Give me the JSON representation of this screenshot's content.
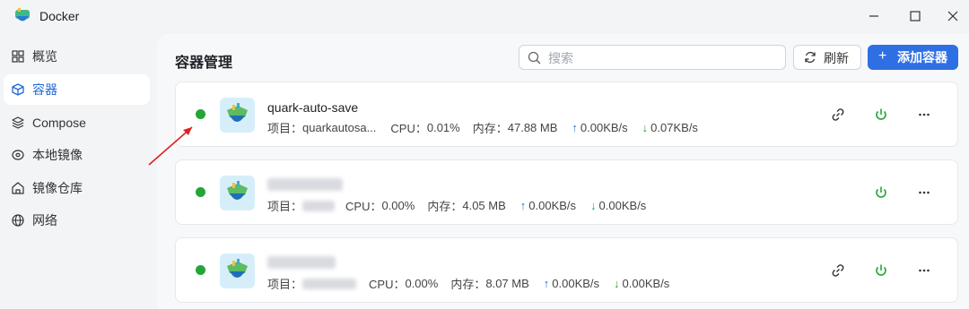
{
  "app": {
    "title": "Docker"
  },
  "sidebar": {
    "items": [
      {
        "label": "概览",
        "icon": "grid-icon"
      },
      {
        "label": "容器",
        "icon": "cube-icon"
      },
      {
        "label": "Compose",
        "icon": "layers-icon"
      },
      {
        "label": "本地镜像",
        "icon": "disc-icon"
      },
      {
        "label": "镜像仓库",
        "icon": "home-icon"
      },
      {
        "label": "网络",
        "icon": "globe-icon"
      }
    ],
    "active_index": 1
  },
  "main": {
    "title": "容器管理",
    "search": {
      "placeholder": "搜索",
      "value": ""
    },
    "refresh_label": "刷新",
    "add_label": "添加容器"
  },
  "containers": [
    {
      "name": "quark-auto-save",
      "status": "running",
      "project_label": "项目：",
      "project": "quarkautosa...",
      "cpu_label": "CPU：",
      "cpu": "0.01%",
      "mem_label": "内存：",
      "mem": "47.88 MB",
      "up": "0.00KB/s",
      "down": "0.07KB/s",
      "actions": [
        "link",
        "power",
        "more"
      ]
    },
    {
      "name": "",
      "status": "running",
      "project_label": "项目：",
      "project": "",
      "cpu_label": "CPU：",
      "cpu": "0.00%",
      "mem_label": "内存：",
      "mem": "4.05 MB",
      "up": "0.00KB/s",
      "down": "0.00KB/s",
      "actions": [
        "power",
        "more"
      ]
    },
    {
      "name": "",
      "status": "running",
      "project_label": "项目：",
      "project": "",
      "cpu_label": "CPU：",
      "cpu": "0.00%",
      "mem_label": "内存：",
      "mem": "8.07 MB",
      "up": "0.00KB/s",
      "down": "0.00KB/s",
      "actions": [
        "link",
        "power",
        "more"
      ]
    }
  ],
  "colors": {
    "accent": "#2f6fe4",
    "running": "#23a637",
    "annotation": "#e02020"
  }
}
